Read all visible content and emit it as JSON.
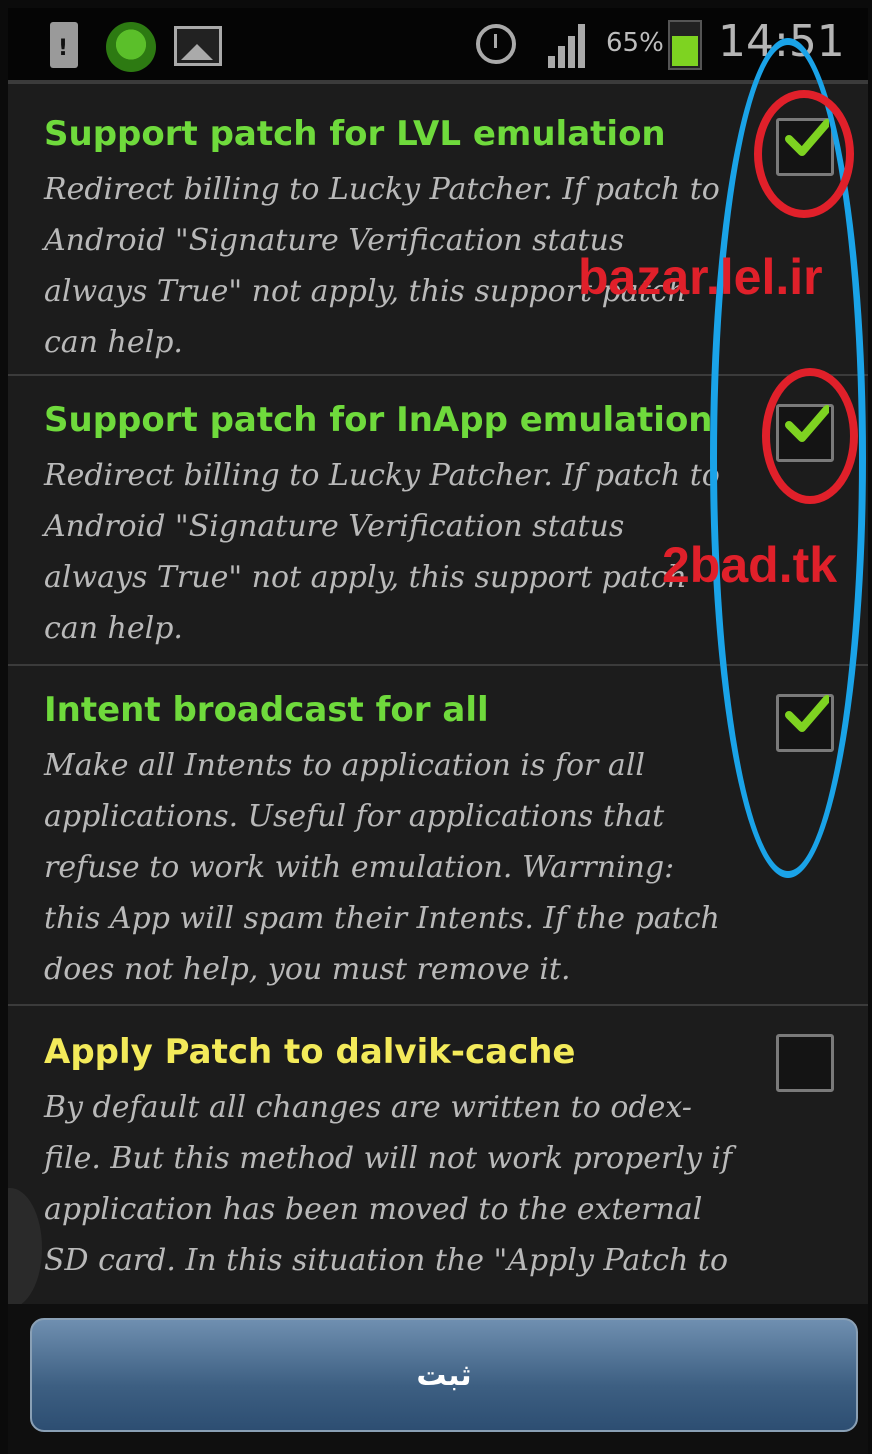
{
  "status_bar": {
    "battery_percent": "65%",
    "battery_level": 0.65,
    "time": "14:51",
    "icons": [
      "sd-card-icon",
      "shield-icon",
      "picture-icon",
      "alarm-icon",
      "signal-icon",
      "battery-icon"
    ]
  },
  "options": [
    {
      "title": "Support patch for LVL emulation",
      "title_color": "#6fda3c",
      "checked": true,
      "description_lines": [
        "Redirect billing to Lucky Patcher. If patch to",
        "Android \"Signature Verification status",
        "always True\" not apply, this support patch",
        "can help."
      ]
    },
    {
      "title": "Support patch for InApp emulation",
      "title_color": "#6fda3c",
      "checked": true,
      "description_lines": [
        "Redirect billing to Lucky Patcher. If patch to",
        "Android \"Signature Verification status",
        "always True\" not apply, this support patch",
        "can help."
      ]
    },
    {
      "title": "Intent broadcast for all",
      "title_color": "#6fda3c",
      "checked": true,
      "description_lines": [
        "Make all Intents to application is for all",
        "applications. Useful for applications that",
        "refuse to work with emulation. Warrning:",
        "this App will spam their Intents. If the patch",
        "does not help, you must remove it."
      ]
    },
    {
      "title": "Apply Patch to dalvik-cache",
      "title_color": "#f3ea5a",
      "checked": false,
      "description_lines": [
        "By default all changes are written to odex-",
        "file. But this method will not work properly if",
        "application has been moved to the external",
        "SD card. In this situation the \"Apply Patch to"
      ]
    }
  ],
  "watermarks": [
    "bazar.lel.ir",
    "2bad.tk"
  ],
  "footer": {
    "button_label": "ثبت"
  },
  "colors": {
    "annotation_red": "#e0202a",
    "annotation_blue": "#1aa3e8",
    "check_green": "#7ed321",
    "button_blue": "#3d5f82"
  }
}
